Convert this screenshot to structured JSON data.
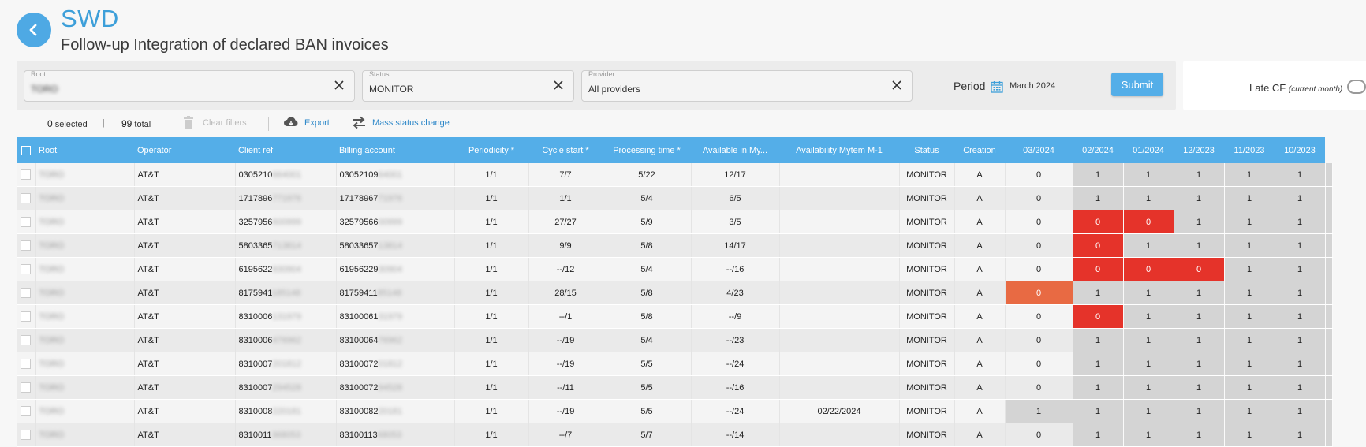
{
  "header": {
    "title": "SWD",
    "subtitle": "Follow-up Integration of declared BAN invoices"
  },
  "filters": {
    "root": {
      "label": "Root",
      "value": "TORO"
    },
    "status": {
      "label": "Status",
      "value": "MONITOR"
    },
    "provider": {
      "label": "Provider",
      "value": "All providers"
    },
    "period_label": "Period",
    "period_value": "March 2024",
    "submit_label": "Submit",
    "late_cf_label": "Late CF",
    "late_cf_sub": "(current month)"
  },
  "toolbar": {
    "selected_count": "0",
    "selected_label": "selected",
    "divider": "|",
    "total_count": "99",
    "total_label": "total",
    "clear_filters": "Clear filters",
    "export": "Export",
    "mass_status_change": "Mass status change"
  },
  "table": {
    "columns": [
      "Root",
      "Operator",
      "Client ref",
      "Billing account",
      "Periodicity *",
      "Cycle start *",
      "Processing time *",
      "Available in My...",
      "Availability Mytem M-1",
      "Status",
      "Creation",
      "03/2024",
      "02/2024",
      "01/2024",
      "12/2023",
      "11/2023",
      "10/2023"
    ],
    "rows": [
      {
        "root": "TORO",
        "operator": "AT&T",
        "client_ref": "0305210",
        "client_ref_hidden": "664001",
        "billing": "03052109",
        "billing_hidden": "64001",
        "periodicity": "1/1",
        "cycle": "7/7",
        "processing": "5/22",
        "available": "12/17",
        "avail_m1": "",
        "status": "MONITOR",
        "creation": "A",
        "m0": "0",
        "h": [
          "1",
          "1",
          "1",
          "1",
          "1"
        ]
      },
      {
        "root": "TORO",
        "operator": "AT&T",
        "client_ref": "1717896",
        "client_ref_hidden": "771976",
        "billing": "17178967",
        "billing_hidden": "71976",
        "periodicity": "1/1",
        "cycle": "1/1",
        "processing": "5/4",
        "available": "6/5",
        "avail_m1": "",
        "status": "MONITOR",
        "creation": "A",
        "m0": "0",
        "h": [
          "1",
          "1",
          "1",
          "1",
          "1"
        ]
      },
      {
        "root": "TORO",
        "operator": "AT&T",
        "client_ref": "3257956",
        "client_ref_hidden": "600999",
        "billing": "32579566",
        "billing_hidden": "00999",
        "periodicity": "1/1",
        "cycle": "27/27",
        "processing": "5/9",
        "available": "3/5",
        "avail_m1": "",
        "status": "MONITOR",
        "creation": "A",
        "m0": "0",
        "h": [
          "0",
          "0",
          "1",
          "1",
          "1"
        ]
      },
      {
        "root": "TORO",
        "operator": "AT&T",
        "client_ref": "5803365",
        "client_ref_hidden": "713814",
        "billing": "58033657",
        "billing_hidden": "13814",
        "periodicity": "1/1",
        "cycle": "9/9",
        "processing": "5/8",
        "available": "14/17",
        "avail_m1": "",
        "status": "MONITOR",
        "creation": "A",
        "m0": "0",
        "h": [
          "0",
          "1",
          "1",
          "1",
          "1"
        ]
      },
      {
        "root": "TORO",
        "operator": "AT&T",
        "client_ref": "6195622",
        "client_ref_hidden": "930904",
        "billing": "61956229",
        "billing_hidden": "30904",
        "periodicity": "1/1",
        "cycle": "--/12",
        "processing": "5/4",
        "available": "--/16",
        "avail_m1": "",
        "status": "MONITOR",
        "creation": "A",
        "m0": "0",
        "h": [
          "0",
          "0",
          "0",
          "1",
          "1"
        ]
      },
      {
        "root": "TORO",
        "operator": "AT&T",
        "client_ref": "8175941",
        "client_ref_hidden": "185148",
        "billing": "81759411",
        "billing_hidden": "85148",
        "periodicity": "1/1",
        "cycle": "28/15",
        "processing": "5/8",
        "available": "4/23",
        "avail_m1": "",
        "status": "MONITOR",
        "creation": "A",
        "m0": "0",
        "h": [
          "1",
          "1",
          "1",
          "1",
          "1"
        ]
      },
      {
        "root": "TORO",
        "operator": "AT&T",
        "client_ref": "8310006",
        "client_ref_hidden": "131979",
        "billing": "83100061",
        "billing_hidden": "31979",
        "periodicity": "1/1",
        "cycle": "--/1",
        "processing": "5/8",
        "available": "--/9",
        "avail_m1": "",
        "status": "MONITOR",
        "creation": "A",
        "m0": "0",
        "h": [
          "0",
          "1",
          "1",
          "1",
          "1"
        ]
      },
      {
        "root": "TORO",
        "operator": "AT&T",
        "client_ref": "8310006",
        "client_ref_hidden": "476962",
        "billing": "83100064",
        "billing_hidden": "76962",
        "periodicity": "1/1",
        "cycle": "--/19",
        "processing": "5/4",
        "available": "--/23",
        "avail_m1": "",
        "status": "MONITOR",
        "creation": "A",
        "m0": "0",
        "h": [
          "1",
          "1",
          "1",
          "1",
          "1"
        ]
      },
      {
        "root": "TORO",
        "operator": "AT&T",
        "client_ref": "8310007",
        "client_ref_hidden": "201812",
        "billing": "83100072",
        "billing_hidden": "01812",
        "periodicity": "1/1",
        "cycle": "--/19",
        "processing": "5/5",
        "available": "--/24",
        "avail_m1": "",
        "status": "MONITOR",
        "creation": "A",
        "m0": "0",
        "h": [
          "1",
          "1",
          "1",
          "1",
          "1"
        ]
      },
      {
        "root": "TORO",
        "operator": "AT&T",
        "client_ref": "8310007",
        "client_ref_hidden": "294528",
        "billing": "83100072",
        "billing_hidden": "94528",
        "periodicity": "1/1",
        "cycle": "--/11",
        "processing": "5/5",
        "available": "--/16",
        "avail_m1": "",
        "status": "MONITOR",
        "creation": "A",
        "m0": "0",
        "h": [
          "1",
          "1",
          "1",
          "1",
          "1"
        ]
      },
      {
        "root": "TORO",
        "operator": "AT&T",
        "client_ref": "8310008",
        "client_ref_hidden": "220181",
        "billing": "83100082",
        "billing_hidden": "20181",
        "periodicity": "1/1",
        "cycle": "--/19",
        "processing": "5/5",
        "available": "--/24",
        "avail_m1": "02/22/2024",
        "status": "MONITOR",
        "creation": "A",
        "m0": "1",
        "h": [
          "1",
          "1",
          "1",
          "1",
          "1"
        ]
      },
      {
        "root": "TORO",
        "operator": "AT&T",
        "client_ref": "8310011",
        "client_ref_hidden": "368053",
        "billing": "83100113",
        "billing_hidden": "68053",
        "periodicity": "1/1",
        "cycle": "--/7",
        "processing": "5/7",
        "available": "--/14",
        "avail_m1": "",
        "status": "MONITOR",
        "creation": "A",
        "m0": "0",
        "h": [
          "1",
          "1",
          "1",
          "1",
          "1"
        ]
      }
    ]
  },
  "colors": {
    "accent": "#54aee8",
    "title": "#3d9fd9",
    "red": "#e5332a",
    "orange": "#e86a43",
    "grey_cell": "#d4d4d4"
  }
}
